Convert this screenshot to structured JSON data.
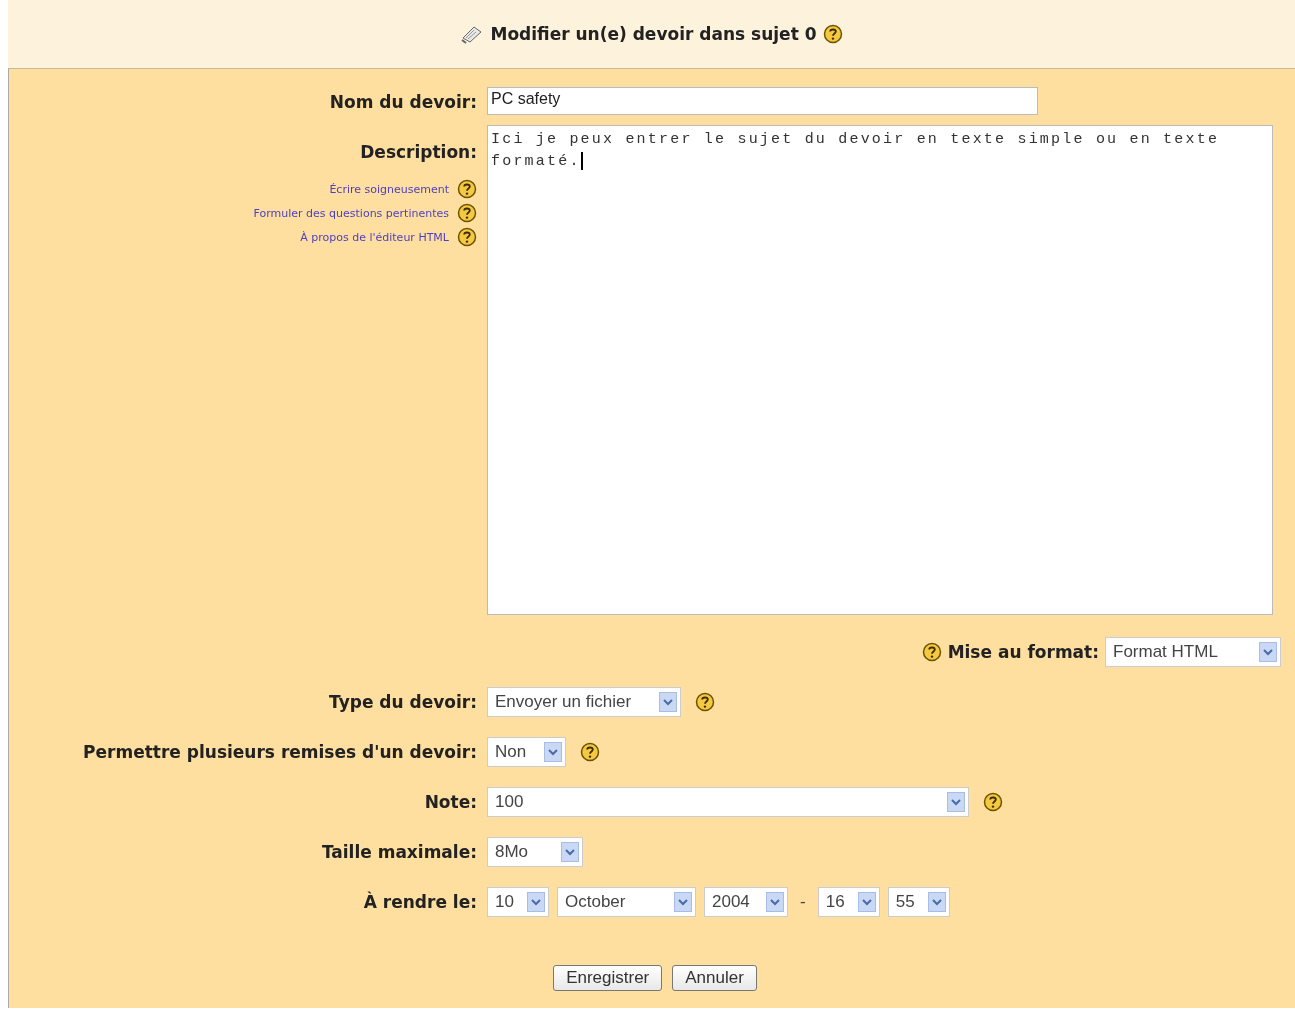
{
  "header": {
    "title": "Modifier un(e) devoir dans sujet 0"
  },
  "fields": [
    {
      "kind": "text",
      "label": "Nom du devoir:",
      "value": "PC safety"
    },
    {
      "kind": "textarea",
      "label": "Description:",
      "value": "Ici je peux entrer le sujet du devoir en texte simple ou en texte formaté.",
      "links": [
        "Écrire soigneusement",
        "Formuler des questions pertinentes",
        "À propos de l'éditeur HTML"
      ],
      "format": {
        "label": "Mise au format:",
        "value": "Format HTML"
      }
    },
    {
      "kind": "select",
      "label": "Type du devoir:",
      "value": "Envoyer un fichier",
      "help": true
    },
    {
      "kind": "select",
      "label": "Permettre plusieurs remises d'un devoir:",
      "value": "Non",
      "help": true
    },
    {
      "kind": "select",
      "label": "Note:",
      "value": "100",
      "help": true
    },
    {
      "kind": "select",
      "label": "Taille maximale:",
      "value": "8Mo",
      "help": false
    },
    {
      "kind": "date",
      "label": "À rendre le:",
      "parts": [
        "10",
        "October",
        "2004"
      ],
      "separator": "-",
      "time": [
        "16",
        "55"
      ]
    }
  ],
  "buttons": [
    "Enregistrer",
    "Annuler"
  ]
}
